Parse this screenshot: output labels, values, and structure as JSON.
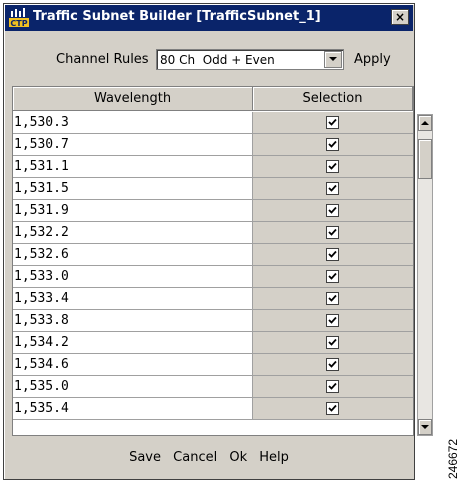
{
  "window": {
    "title": "Traffic Subnet Builder [TrafficSubnet_1]",
    "close_label": "×",
    "title_bar_color": "#0a246a",
    "icon": "ctp-app-icon",
    "icon_label": "CTP"
  },
  "rules": {
    "label": "Channel Rules",
    "selected": "80 Ch  Odd + Even",
    "apply_label": "Apply"
  },
  "table": {
    "columns": [
      "Wavelength",
      "Selection"
    ],
    "rows": [
      {
        "wavelength": "1,530.3",
        "selected": true
      },
      {
        "wavelength": "1,530.7",
        "selected": true
      },
      {
        "wavelength": "1,531.1",
        "selected": true
      },
      {
        "wavelength": "1,531.5",
        "selected": true
      },
      {
        "wavelength": "1,531.9",
        "selected": true
      },
      {
        "wavelength": "1,532.2",
        "selected": true
      },
      {
        "wavelength": "1,532.6",
        "selected": true
      },
      {
        "wavelength": "1,533.0",
        "selected": true
      },
      {
        "wavelength": "1,533.4",
        "selected": true
      },
      {
        "wavelength": "1,533.8",
        "selected": true
      },
      {
        "wavelength": "1,534.2",
        "selected": true
      },
      {
        "wavelength": "1,534.6",
        "selected": true
      },
      {
        "wavelength": "1,535.0",
        "selected": true
      },
      {
        "wavelength": "1,535.4",
        "selected": true
      }
    ]
  },
  "footer": {
    "save_label": "Save",
    "cancel_label": "Cancel",
    "ok_label": "Ok",
    "help_label": "Help"
  },
  "figure_id": "246672"
}
